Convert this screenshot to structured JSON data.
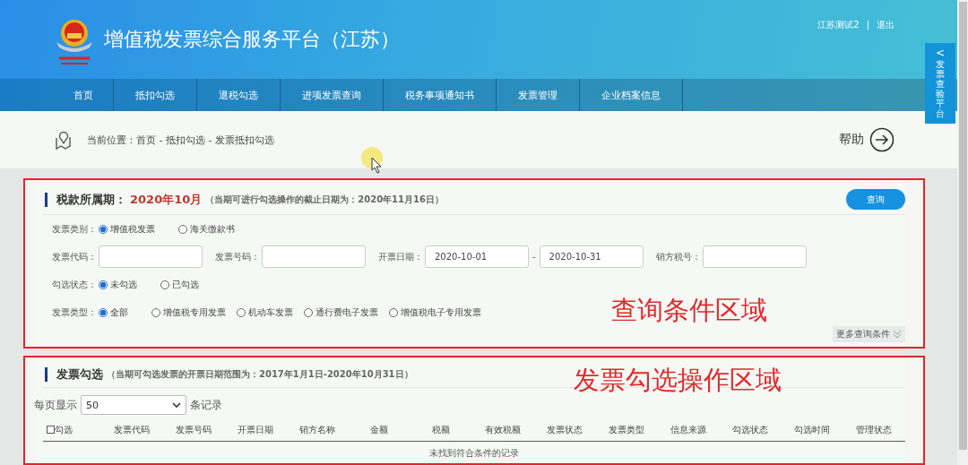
{
  "header": {
    "title": "增值税发票综合服务平台（江苏）",
    "user": "江苏测试2",
    "separator": "|",
    "logout": "退出"
  },
  "nav": {
    "items": [
      {
        "label": "首页"
      },
      {
        "label": "抵扣勾选"
      },
      {
        "label": "退税勾选"
      },
      {
        "label": "进项发票查询"
      },
      {
        "label": "税务事项通知书"
      },
      {
        "label": "发票管理"
      },
      {
        "label": "企业档案信息"
      }
    ]
  },
  "side_tab": {
    "arrow": "<",
    "label": "发票查验平台"
  },
  "breadcrumb": {
    "text": "当前位置：首页 - 抵扣勾选 - 发票抵扣勾选"
  },
  "help": {
    "label": "帮助"
  },
  "query_section": {
    "title": "税款所属期：",
    "period": "2020年10月",
    "note": "（当期可进行勾选操作的截止日期为：2020年11月16日）",
    "button": "查询",
    "rows": [
      {
        "kind": "radio",
        "label": "发票类别：",
        "options": [
          {
            "label": "增值税发票",
            "selected": true
          },
          {
            "label": "海关缴款书",
            "selected": false
          }
        ]
      },
      {
        "kind": "fields",
        "fields": [
          {
            "label": "发票代码："
          },
          {
            "label": "发票号码："
          },
          {
            "label": "开票日期：",
            "value": "2020-10-01",
            "range_sep": "-",
            "value2": "2020-10-31"
          },
          {
            "label": "销方税号："
          }
        ]
      },
      {
        "kind": "radio",
        "label": "勾选状态：",
        "options": [
          {
            "label": "未勾选",
            "selected": true
          },
          {
            "label": "已勾选",
            "selected": false
          }
        ]
      },
      {
        "kind": "radio",
        "label": "发票类型：",
        "options": [
          {
            "label": "全部",
            "selected": true
          },
          {
            "label": "增值税专用发票",
            "selected": false
          },
          {
            "label": "机动车发票",
            "selected": false
          },
          {
            "label": "通行费电子发票",
            "selected": false
          },
          {
            "label": "增值税电子专用发票",
            "selected": false
          }
        ]
      }
    ],
    "more": "更多查询条件",
    "annotation": "查询条件区域"
  },
  "selection_section": {
    "title": "发票勾选",
    "note": "（当期可勾选发票的开票日期范围为：2017年1月1日-2020年10月31日）",
    "page_size_label": "每页显示",
    "page_size": "50",
    "page_size_suffix": "条记录",
    "select_all": {
      "label": "勾选",
      "checked": false
    },
    "columns": [
      "发票代码",
      "发票号码",
      "开票日期",
      "销方名称",
      "金额",
      "税额",
      "有效税额",
      "发票状态",
      "发票类型",
      "信息来源",
      "勾选状态",
      "勾选时间",
      "管理状态"
    ],
    "empty_message": "未找到符合条件的记录",
    "annotation": "发票勾选操作区域"
  }
}
